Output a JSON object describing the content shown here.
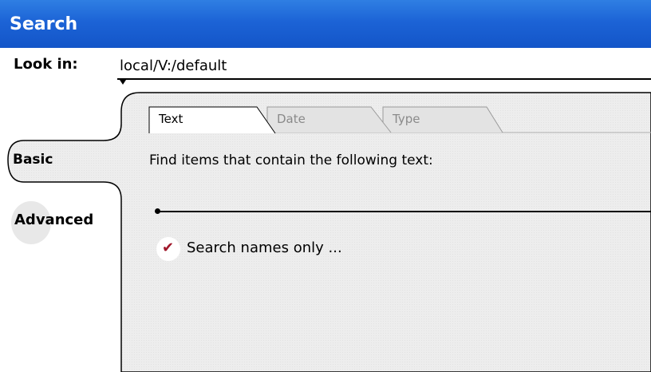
{
  "window": {
    "title": "Search"
  },
  "look_in": {
    "label": "Look in:",
    "value": "local/V:/default"
  },
  "tabs": [
    {
      "label": "Text",
      "active": true
    },
    {
      "label": "Date",
      "active": false
    },
    {
      "label": "Type",
      "active": false
    }
  ],
  "modes": [
    {
      "label": "Basic",
      "active": true
    },
    {
      "label": "Advanced",
      "active": false
    }
  ],
  "find": {
    "label": "Find items that contain the following text:",
    "value": ""
  },
  "options": {
    "search_names_only": {
      "label": "Search names only ...",
      "checked": true
    }
  },
  "colors": {
    "titlebar": "#1c63d6",
    "panel": "#efefef",
    "checkmark": "#a0172a"
  },
  "icons": {
    "dropdown": "small-triangle-down",
    "check": "checkmark"
  }
}
